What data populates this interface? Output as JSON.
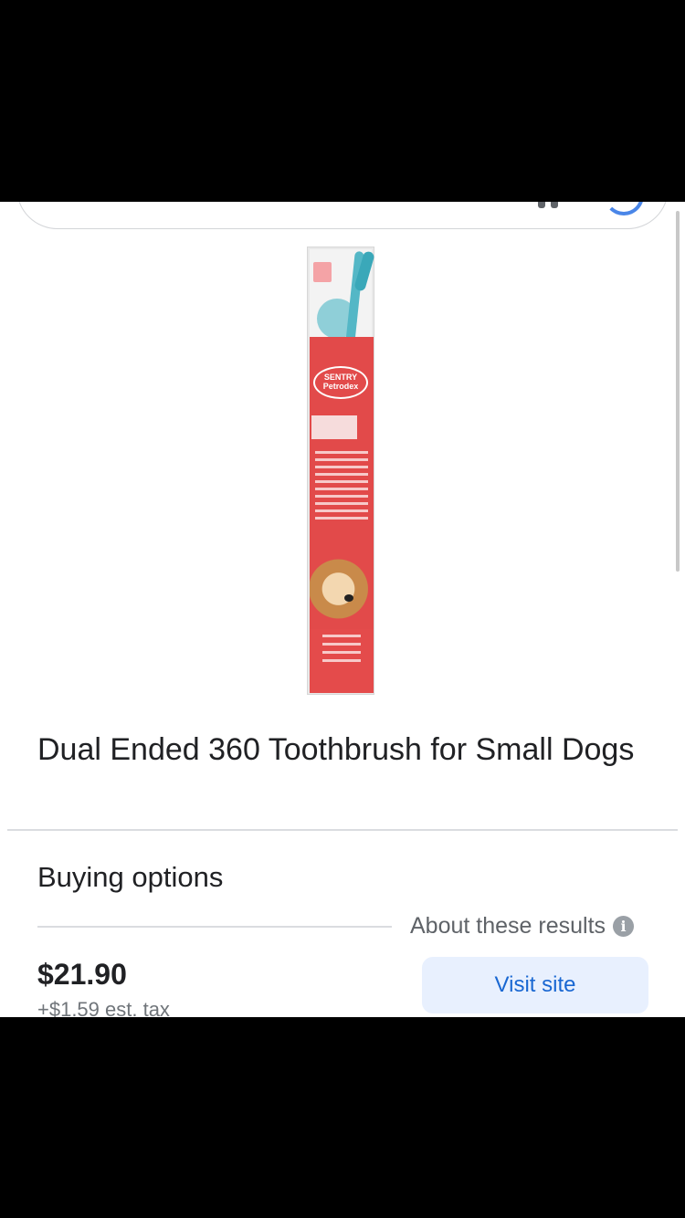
{
  "product": {
    "title": "Dual Ended 360 Toothbrush for Small Dogs",
    "image_icon": "toothbrush-package-image",
    "package_brand": "SENTRY Petrodex"
  },
  "buying_options": {
    "heading": "Buying options",
    "about_label": "About these results",
    "info_icon_glyph": "i"
  },
  "offer": {
    "price": "$21.90",
    "tax": "+$1.59 est. tax",
    "visit_label": "Visit site"
  },
  "colors": {
    "accent": "#1967d2",
    "button_bg": "#e8f0fe",
    "text": "#202124",
    "muted": "#5f6368"
  }
}
